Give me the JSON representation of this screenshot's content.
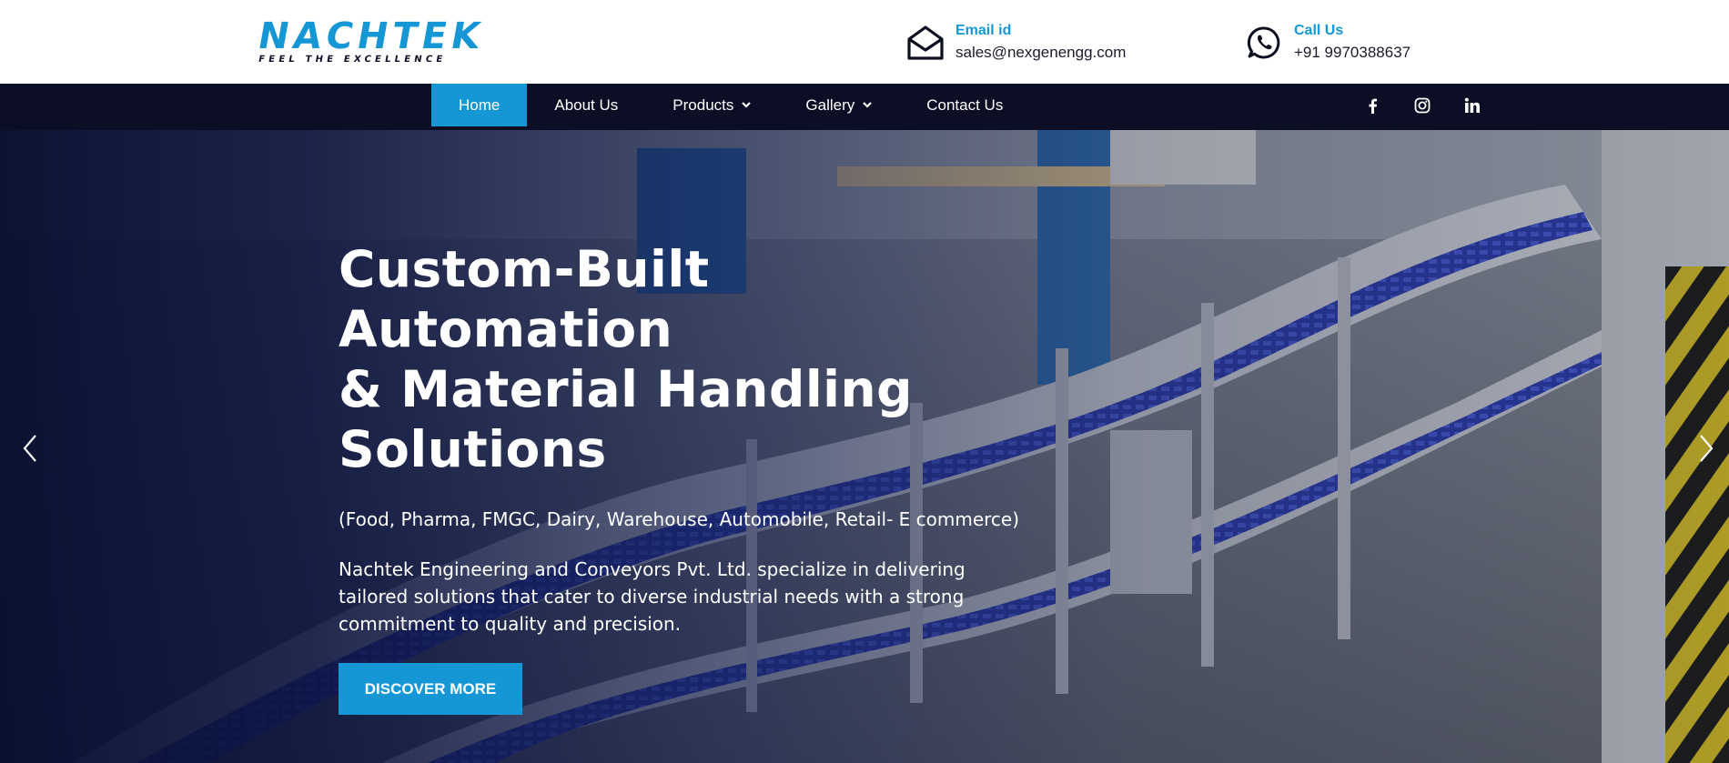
{
  "brand": {
    "name": "NACHTEK",
    "tagline": "FEEL THE EXCELLENCE"
  },
  "header": {
    "email": {
      "label": "Email id",
      "value": "sales@nexgenengg.com",
      "icon": "envelope-icon"
    },
    "phone": {
      "label": "Call Us",
      "value": "+91 9970388637",
      "icon": "whatsapp-icon"
    }
  },
  "nav": {
    "items": [
      {
        "label": "Home",
        "active": true
      },
      {
        "label": "About Us"
      },
      {
        "label": "Products",
        "dropdown": true
      },
      {
        "label": "Gallery",
        "dropdown": true
      },
      {
        "label": "Contact Us"
      }
    ],
    "social": [
      "facebook-icon",
      "instagram-icon",
      "linkedin-icon"
    ]
  },
  "hero": {
    "title_lines": [
      "Custom-Built Automation",
      "& Material Handling",
      "Solutions"
    ],
    "subtitle": "(Food, Pharma, FMGC, Dairy, Warehouse, Automobile, Retail- E commerce)",
    "description": "Nachtek Engineering and Conveyors Pvt. Ltd. specialize in delivering tailored solutions that cater to diverse industrial needs with a strong commitment to quality and precision.",
    "cta": "DISCOVER MORE"
  },
  "colors": {
    "accent": "#1597d6",
    "navbar": "#0b0e25",
    "text_dark": "#1b1b2b"
  }
}
